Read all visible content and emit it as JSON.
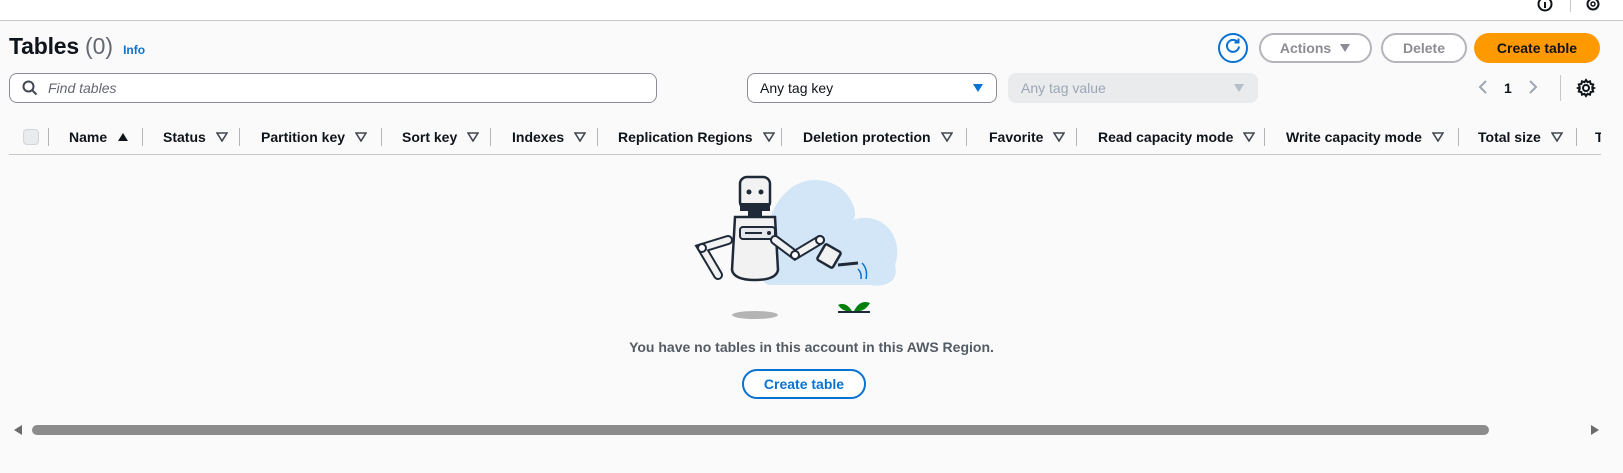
{
  "page": {
    "title": "Tables",
    "count": "(0)",
    "info_link": "Info"
  },
  "toolbar": {
    "refresh_icon": "refresh-icon",
    "actions_label": "Actions",
    "delete_label": "Delete",
    "create_label": "Create table"
  },
  "filters": {
    "search_placeholder": "Find tables",
    "search_value": "",
    "tag_key": "Any tag key",
    "tag_value": "Any tag value"
  },
  "pagination": {
    "page": "1"
  },
  "columns": [
    {
      "label": "Name",
      "sorted": "asc"
    },
    {
      "label": "Status"
    },
    {
      "label": "Partition key"
    },
    {
      "label": "Sort key"
    },
    {
      "label": "Indexes"
    },
    {
      "label": "Replication Regions"
    },
    {
      "label": "Deletion protection"
    },
    {
      "label": "Favorite"
    },
    {
      "label": "Read capacity mode"
    },
    {
      "label": "Write capacity mode"
    },
    {
      "label": "Total size"
    },
    {
      "label": "T"
    }
  ],
  "empty_state": {
    "message": "You have no tables in this account in this AWS Region.",
    "button": "Create table"
  },
  "colors": {
    "accent": "#0972d3",
    "primary_button": "#ff9900",
    "disabled_text": "#9ba7b6"
  }
}
